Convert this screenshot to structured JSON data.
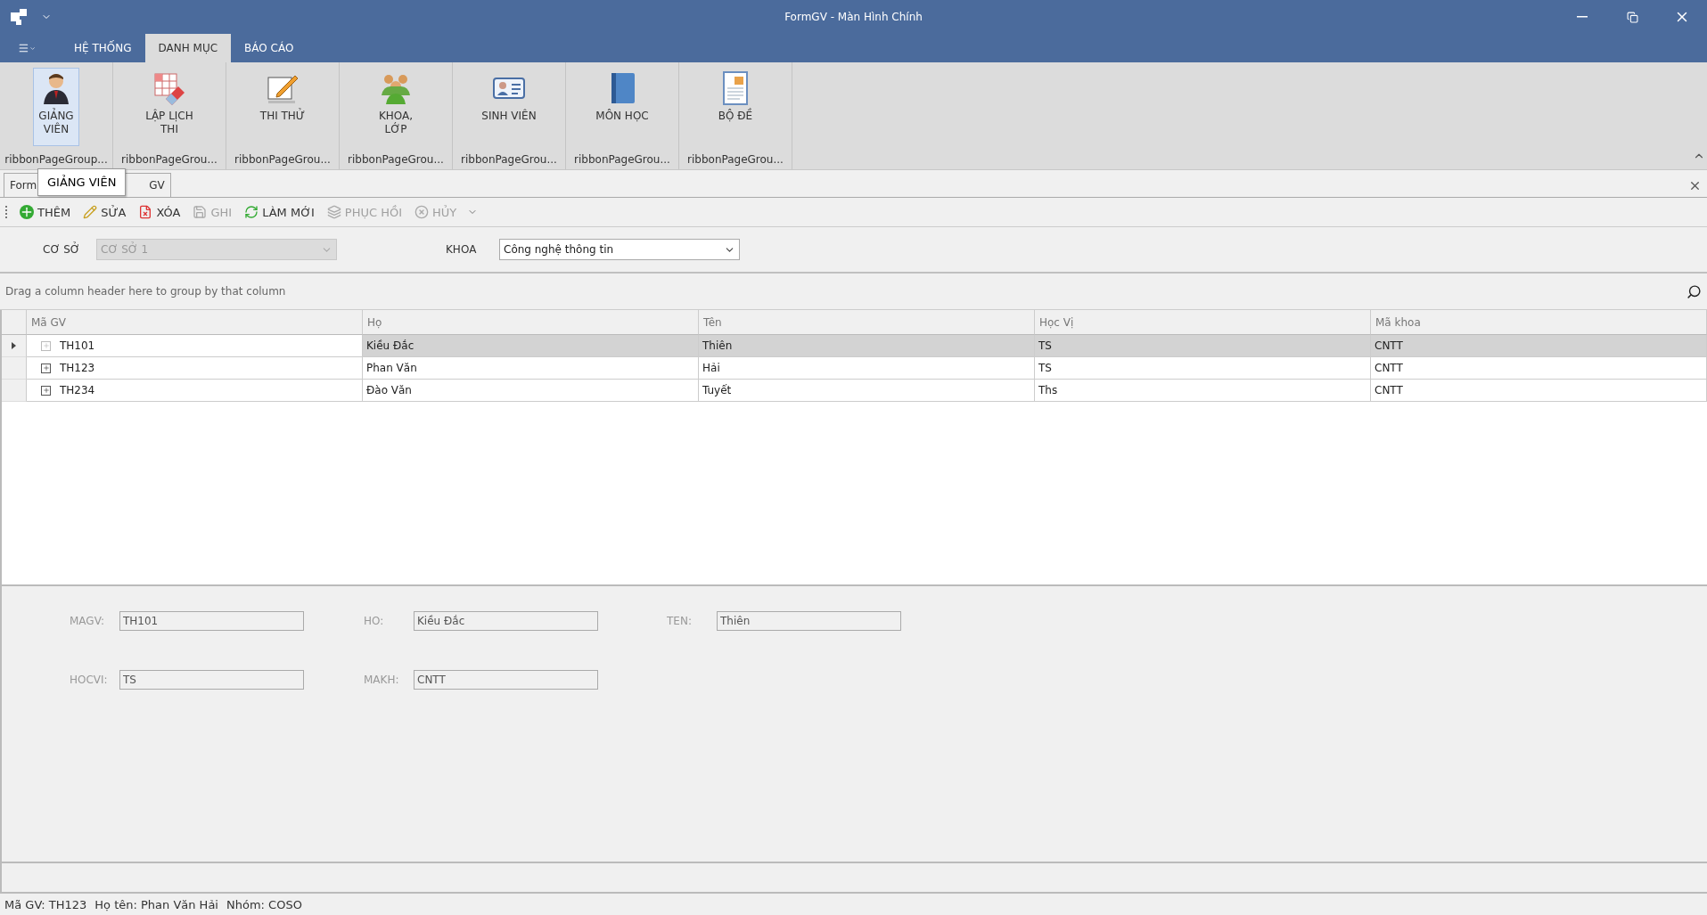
{
  "window": {
    "title": "FormGV - Màn Hình Chính"
  },
  "ribbon_tabs": [
    {
      "label": "HỆ THỐNG",
      "selected": false
    },
    {
      "label": "DANH MỤC",
      "selected": true
    },
    {
      "label": "BÁO CÁO",
      "selected": false
    }
  ],
  "ribbon_groups": [
    {
      "kind": "teacher",
      "label": "GIẢNG\nVIÊN",
      "selected": true,
      "caption": "ribbonPageGroup..."
    },
    {
      "kind": "schedule",
      "label": "LẬP LỊCH\nTHI",
      "selected": false,
      "caption": "ribbonPageGrou..."
    },
    {
      "kind": "test",
      "label": "THI THỬ",
      "selected": false,
      "caption": "ribbonPageGrou..."
    },
    {
      "kind": "group",
      "label": "KHOA,\nLỚP",
      "selected": false,
      "caption": "ribbonPageGrou..."
    },
    {
      "kind": "student",
      "label": "SINH VIÊN",
      "selected": false,
      "caption": "ribbonPageGrou..."
    },
    {
      "kind": "subject",
      "label": "MÔN HỌC",
      "selected": false,
      "caption": "ribbonPageGrou..."
    },
    {
      "kind": "exam",
      "label": "BỘ ĐỀ",
      "selected": false,
      "caption": "ribbonPageGrou..."
    }
  ],
  "tooltip": {
    "text": "GIẢNG VIÊN"
  },
  "document_tab": {
    "label_start": "Form",
    "label_end": "GV"
  },
  "toolbar": [
    {
      "kind": "add",
      "label": "THÊM",
      "disabled": false
    },
    {
      "kind": "edit",
      "label": "SỬA",
      "disabled": false
    },
    {
      "kind": "delete",
      "label": "XÓA",
      "disabled": false
    },
    {
      "kind": "save",
      "label": "GHI",
      "disabled": true
    },
    {
      "kind": "refresh",
      "label": "LÀM MỚI",
      "disabled": false
    },
    {
      "kind": "restore",
      "label": "PHỤC HỒI",
      "disabled": true
    },
    {
      "kind": "cancel",
      "label": "HỦY",
      "disabled": true
    }
  ],
  "filters": [
    {
      "label": "CƠ SỞ",
      "value": "CƠ SỞ 1",
      "disabled": true
    },
    {
      "label": "KHOA",
      "value": "Công nghệ thông tin",
      "disabled": false
    }
  ],
  "grid": {
    "group_hint": "Drag a column header here to group by that column",
    "columns": [
      "Mã GV",
      "Họ",
      "Tên",
      "Học Vị",
      "Mã khoa"
    ],
    "rows": [
      {
        "selected": true,
        "cells": [
          "TH101",
          "Kiều Đắc",
          "Thiên",
          "TS",
          "CNTT"
        ]
      },
      {
        "selected": false,
        "cells": [
          "TH123",
          "Phan Văn",
          "Hải",
          "TS",
          "CNTT"
        ]
      },
      {
        "selected": false,
        "cells": [
          "TH234",
          "Đào Văn",
          "Tuyết",
          "Ths",
          "CNTT"
        ]
      }
    ]
  },
  "details": [
    [
      {
        "label": "MAGV:",
        "value": "TH101"
      },
      {
        "label": "HO:",
        "value": "Kiều Đắc"
      },
      {
        "label": "TEN:",
        "value": "Thiên"
      }
    ],
    [
      {
        "label": "HOCVI:",
        "value": "TS"
      },
      {
        "label": "MAKH:",
        "value": "CNTT"
      }
    ]
  ],
  "status_bar": [
    "Mã GV: TH123",
    "Họ tên: Phan Văn Hải",
    "Nhóm: COSO"
  ]
}
